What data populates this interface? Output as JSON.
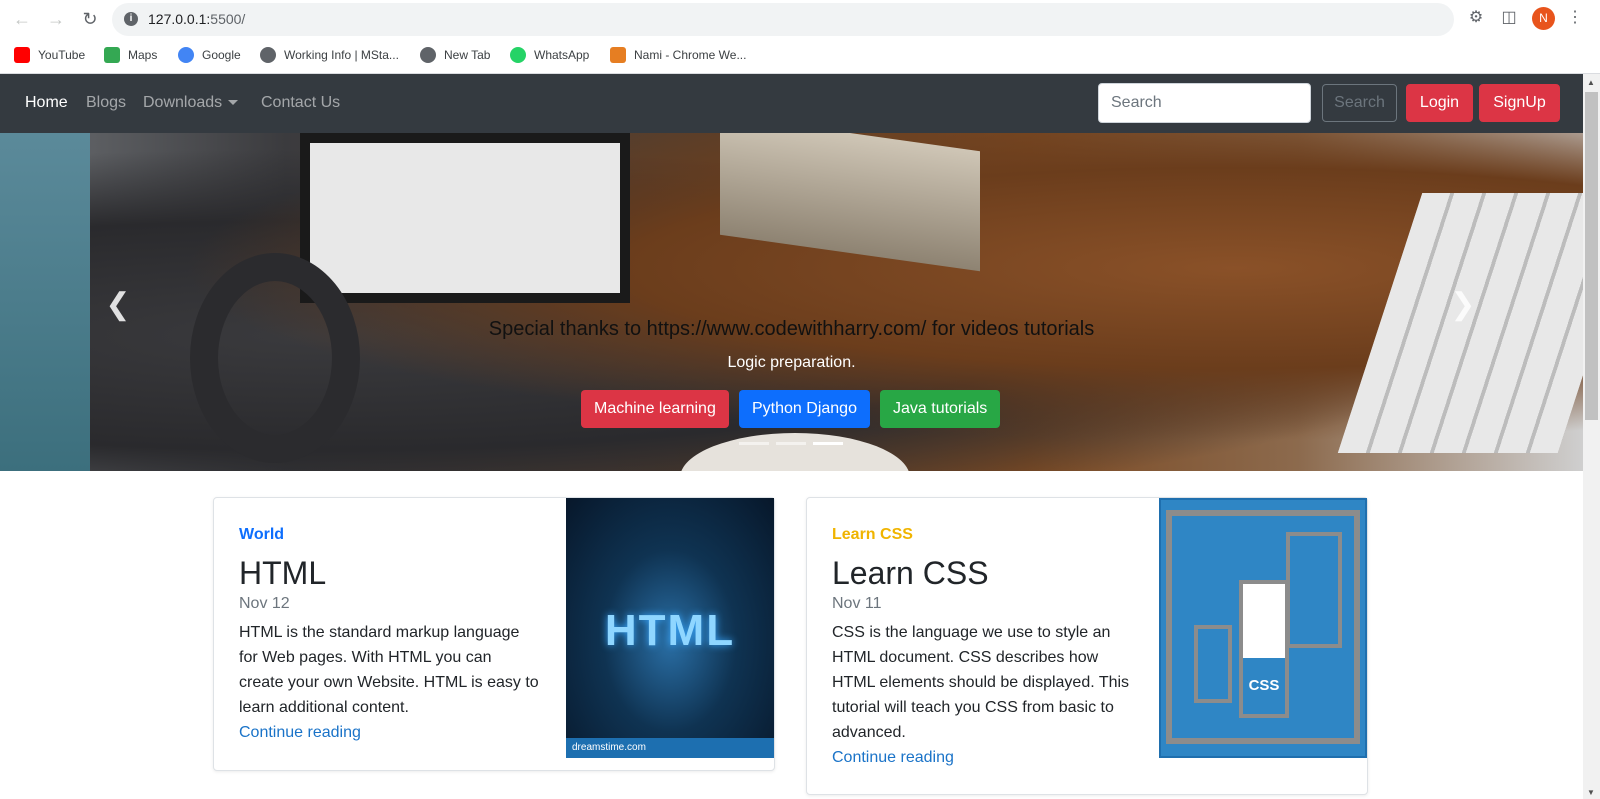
{
  "browser": {
    "url_host": "127.0.0.1:",
    "url_rest": "5500/",
    "avatar_letter": "N",
    "bookmarks": [
      {
        "label": "YouTube",
        "icon": "youtube-icon",
        "color": "#ff0000"
      },
      {
        "label": "Maps",
        "icon": "maps-icon",
        "color": "#34a853"
      },
      {
        "label": "Google",
        "icon": "google-icon",
        "color": "#4285f4"
      },
      {
        "label": "Working Info | MSta...",
        "icon": "globe-icon",
        "color": "#5f6368"
      },
      {
        "label": "New Tab",
        "icon": "globe-icon",
        "color": "#5f6368"
      },
      {
        "label": "WhatsApp",
        "icon": "whatsapp-icon",
        "color": "#25d366"
      },
      {
        "label": "Nami - Chrome We...",
        "icon": "nami-icon",
        "color": "#e67e22"
      }
    ]
  },
  "navbar": {
    "links": [
      "Home",
      "Blogs",
      "Downloads",
      "Contact Us"
    ],
    "search_placeholder": "Search",
    "search_button": "Search",
    "login": "Login",
    "signup": "SignUp"
  },
  "carousel": {
    "title": "Special thanks to https://www.codewithharry.com/ for videos tutorials",
    "subtitle": "Logic preparation.",
    "buttons": [
      {
        "label": "Machine learning",
        "color": "#dc3545"
      },
      {
        "label": "Python Django",
        "color": "#0d6efd"
      },
      {
        "label": "Java tutorials",
        "color": "#28a745"
      }
    ],
    "active_slide": 3
  },
  "cards": [
    {
      "category": "World",
      "category_color": "#0d6efd",
      "title": "HTML",
      "date": "Nov 12",
      "text": "HTML is the standard markup language for Web pages. With HTML you can create your own Website. HTML is easy to learn additional content.",
      "link": "Continue reading",
      "image_text": "HTML",
      "image_footer": "dreamstime.com"
    },
    {
      "category": "Learn CSS",
      "category_color": "#ffc107",
      "title": "Learn CSS",
      "date": "Nov 11",
      "text": "CSS is the language we use to style an HTML document. CSS describes how HTML elements should be displayed. This tutorial will teach you CSS from basic to advanced.",
      "link": "Continue reading",
      "image_text": "CSS"
    }
  ]
}
